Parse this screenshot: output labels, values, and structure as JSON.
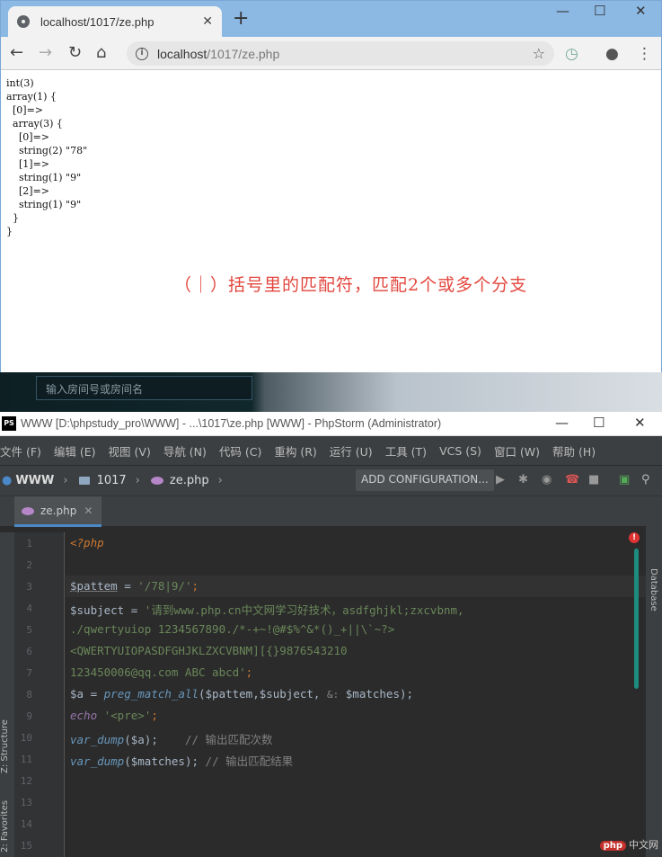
{
  "browser": {
    "tab_title": "localhost/1017/ze.php",
    "tab_close": "✕",
    "new_tab": "+",
    "url_host": "localhost",
    "url_path": "/1017/ze.php",
    "window_controls": [
      "—",
      "☐",
      "✕"
    ]
  },
  "page": {
    "output_lines": [
      "int(3)",
      "array(1) {",
      "  [0]=>",
      "  array(3) {",
      "    [0]=>",
      "    string(2) \"78\"",
      "    [1]=>",
      "    string(1) \"9\"",
      "    [2]=>",
      "    string(1) \"9\"",
      "  }",
      "}"
    ],
    "note": "（｜）括号里的匹配符，匹配2个或多个分支"
  },
  "room_input": {
    "placeholder": "输入房间号或房间名"
  },
  "ide": {
    "title": "WWW [D:\\phpstudy_pro\\WWW] - ...\\1017\\ze.php [WWW] - PhpStorm (Administrator)",
    "logo": "PS",
    "menu": [
      "文件 (F)",
      "编辑 (E)",
      "视图 (V)",
      "导航 (N)",
      "代码 (C)",
      "重构 (R)",
      "运行 (U)",
      "工具 (T)",
      "VCS (S)",
      "窗口 (W)",
      "帮助 (H)"
    ],
    "breadcrumb": [
      "WWW",
      "1017",
      "ze.php"
    ],
    "add_config": "ADD CONFIGURATION...",
    "file_tab": "ze.php",
    "left_tools": [
      "Z: Structure",
      "2: Favorites"
    ],
    "right_tools": [
      "Database"
    ],
    "line_numbers": [
      "1",
      "2",
      "3",
      "4",
      "5",
      "6",
      "7",
      "8",
      "9",
      "10",
      "11",
      "12",
      "13",
      "14",
      "15"
    ],
    "code": {
      "l1": "<?php",
      "l3_var": "$pattem",
      "l3_eq": " = ",
      "l3_str": "'/78|9/'",
      "l3_end": ";",
      "l4_var": "$subject",
      "l4_eq": " = ",
      "l4_str": "'请到www.php.cn中文网学习好技术，asdfghjkl;zxcvbnm,",
      "l5_str": "./qwertyuiop 1234567890./*-+~!@#$%^&*()_+||\\`~?>",
      "l6_str": "<QWERTYUIOPASDFGHJKLZXCVBNM][{}9876543210",
      "l7_str": "123450006@qq.com ABC abcd'",
      "l7_end": ";",
      "l8_var": "$a",
      "l8_eq": " = ",
      "l8_fn": "preg_match_all",
      "l8_args1": "($pattem,$subject, ",
      "l8_hint": "&:",
      "l8_args2": " $matches);",
      "l9_kw": "echo",
      "l9_str": " '<pre>'",
      "l9_end": ";",
      "l10_fn": "var_dump",
      "l10_args": "($a);",
      "l10_cm": "    // 输出匹配次数",
      "l11_fn": "var_dump",
      "l11_args": "($matches);",
      "l11_cm": " // 输出匹配结果"
    },
    "error_badge": "!"
  },
  "watermark": {
    "badge": "php",
    "text": "中文网"
  }
}
